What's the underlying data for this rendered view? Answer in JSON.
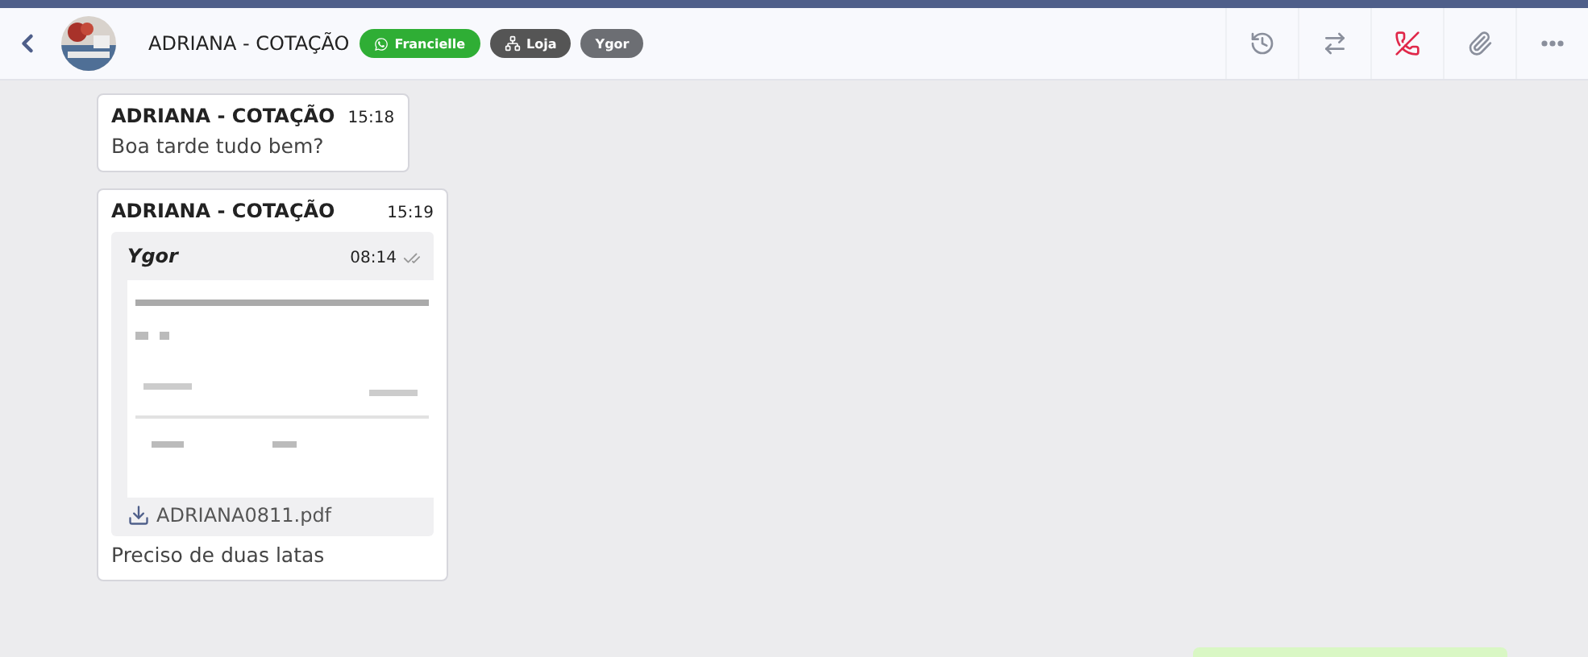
{
  "header": {
    "title": "ADRIANA - COTAÇÃO",
    "tags": [
      {
        "label": "Francielle",
        "kind": "whatsapp"
      },
      {
        "label": "Loja",
        "kind": "department"
      },
      {
        "label": "Ygor",
        "kind": "user"
      }
    ],
    "actions": [
      {
        "kind": "history"
      },
      {
        "kind": "transfer"
      },
      {
        "kind": "call-off"
      },
      {
        "kind": "attach"
      },
      {
        "kind": "more"
      }
    ]
  },
  "messages": [
    {
      "kind": "text",
      "sender": "ADRIANA - COTAÇÃO",
      "time": "15:18",
      "text": "Boa tarde tudo bem?"
    },
    {
      "kind": "quote",
      "sender": "ADRIANA - COTAÇÃO",
      "time": "15:19",
      "quote": {
        "sender": "Ygor",
        "time": "08:14",
        "file": "ADRIANA0811.pdf"
      },
      "text": "Preciso de duas latas"
    },
    {
      "kind": "outgoing"
    }
  ]
}
